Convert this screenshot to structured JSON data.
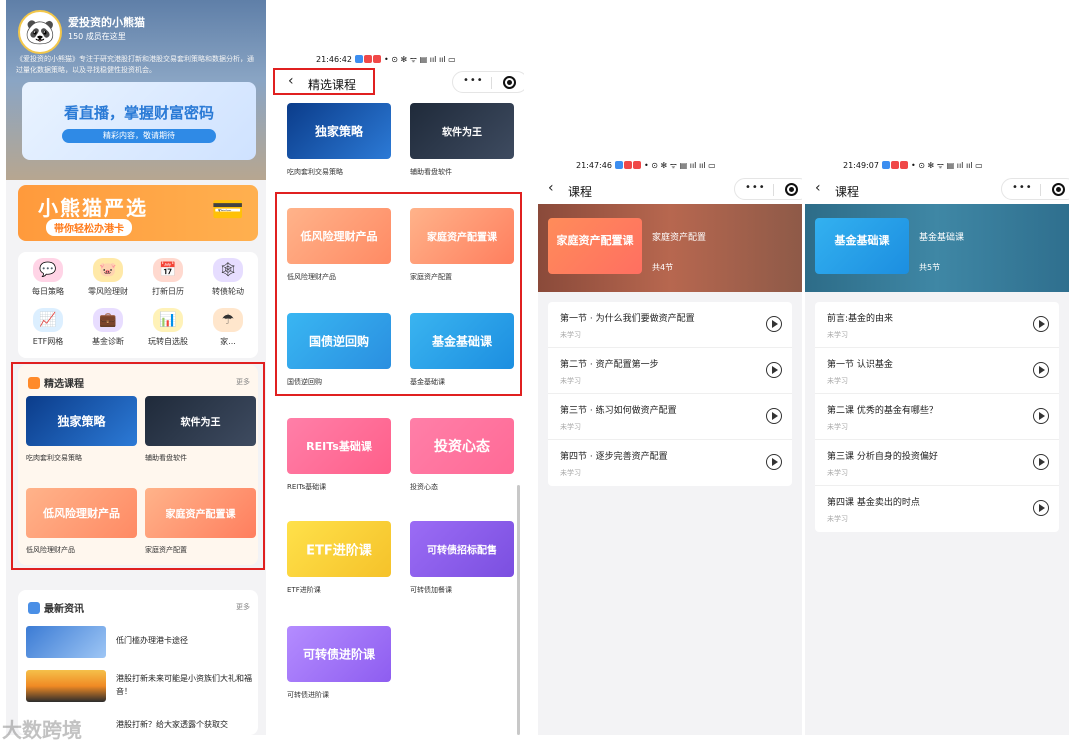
{
  "panel1": {
    "profile": {
      "name": "爱投资的小熊猫",
      "members": "150 成员在这里",
      "description": "《爱投资的小熊猫》专注于研究港股打新和港股交易套利策略和数据分析，通过量化数据策略，以及寻找稳健性投资机会。"
    },
    "banner": {
      "title": "看直播，掌握财富密码",
      "subtitle": "精彩内容，敬请期待"
    },
    "promo": {
      "title": "小熊猫严选",
      "subtitle": "带你轻松办港卡"
    },
    "grid": [
      {
        "label": "每日策略",
        "icon": "chat-icon",
        "color": "#ffd4e6"
      },
      {
        "label": "零风险理财",
        "icon": "piggy-icon",
        "color": "#ffe9a8"
      },
      {
        "label": "打新日历",
        "icon": "ipo-calendar-icon",
        "color": "#ffd9cf"
      },
      {
        "label": "转债轮动",
        "icon": "network-icon",
        "color": "#e6ddff"
      },
      {
        "label": "ETF网格",
        "icon": "chart-icon",
        "color": "#dcefff"
      },
      {
        "label": "基金诊断",
        "icon": "doctor-bag-icon",
        "color": "#e8ddff"
      },
      {
        "label": "玩转自选股",
        "icon": "bars-icon",
        "color": "#fff2b8"
      },
      {
        "label": "家...",
        "icon": "umbrella-icon",
        "color": "#ffe6cc"
      }
    ],
    "selected": {
      "title": "精选课程",
      "more": "更多",
      "items": [
        {
          "thumb": "独家策略",
          "caption": "吃肉套利交易策略"
        },
        {
          "thumb": "软件为王",
          "caption": "辅助看盘软件"
        },
        {
          "thumb": "低风险理财产品",
          "caption": "低风险理财产品"
        },
        {
          "thumb": "家庭资产配置课",
          "caption": "家庭资产配置"
        }
      ]
    },
    "news": {
      "title": "最新资讯",
      "more": "更多",
      "items": [
        {
          "text": "低门槛办理港卡途径"
        },
        {
          "text": "港股打新未来可能是小资族们大礼和福音！"
        },
        {
          "text": "港股打新？给大家透露个获取交"
        }
      ]
    }
  },
  "panel2": {
    "status": {
      "time": "21:46:42"
    },
    "nav": {
      "title": "精选课程"
    },
    "courses": [
      {
        "thumb": "独家策略",
        "caption": "吃肉套利交易策略"
      },
      {
        "thumb": "软件为王",
        "caption": "辅助看盘软件"
      },
      {
        "thumb": "低风险理财产品",
        "caption": "低风险理财产品"
      },
      {
        "thumb": "家庭资产配置课",
        "caption": "家庭资产配置"
      },
      {
        "thumb": "国债逆回购",
        "caption": "国债逆回购"
      },
      {
        "thumb": "基金基础课",
        "caption": "基金基础课"
      },
      {
        "thumb": "REITs基础课",
        "caption": "REITs基础课"
      },
      {
        "thumb": "投资心态",
        "caption": "投资心态"
      },
      {
        "thumb": "ETF进阶课",
        "caption": "ETF进阶课"
      },
      {
        "thumb": "可转债招标配售",
        "caption": "可转债加餐课"
      },
      {
        "thumb": "可转债进阶课",
        "caption": "可转债进阶课"
      }
    ]
  },
  "panel3": {
    "status": {
      "time": "21:47:46"
    },
    "nav": {
      "title": "课程"
    },
    "hero": {
      "card": "家庭资产配置课",
      "name": "家庭资产配置",
      "count": "共4节"
    },
    "lessons": [
      {
        "title": "第一节 · 为什么我们要做资产配置",
        "state": "未学习"
      },
      {
        "title": "第二节 · 资产配置第一步",
        "state": "未学习"
      },
      {
        "title": "第三节 · 练习如何做资产配置",
        "state": "未学习"
      },
      {
        "title": "第四节 · 逐步完善资产配置",
        "state": "未学习"
      }
    ]
  },
  "panel4": {
    "status": {
      "time": "21:49:07"
    },
    "nav": {
      "title": "课程"
    },
    "hero": {
      "card": "基金基础课",
      "name": "基金基础课",
      "count": "共5节"
    },
    "lessons": [
      {
        "title": "前言:基金的由来",
        "state": "未学习"
      },
      {
        "title": "第一节 认识基金",
        "state": "未学习"
      },
      {
        "title": "第二课 优秀的基金有哪些？",
        "state": "未学习"
      },
      {
        "title": "第三课 分析自身的投资偏好",
        "state": "未学习"
      },
      {
        "title": "第四课 基金卖出的时点",
        "state": "未学习"
      }
    ]
  },
  "watermark": "大数跨境",
  "colors": {
    "highlight": "#e02020",
    "accent": "#ff8a2a",
    "brand_blue": "#2a7ad6"
  }
}
